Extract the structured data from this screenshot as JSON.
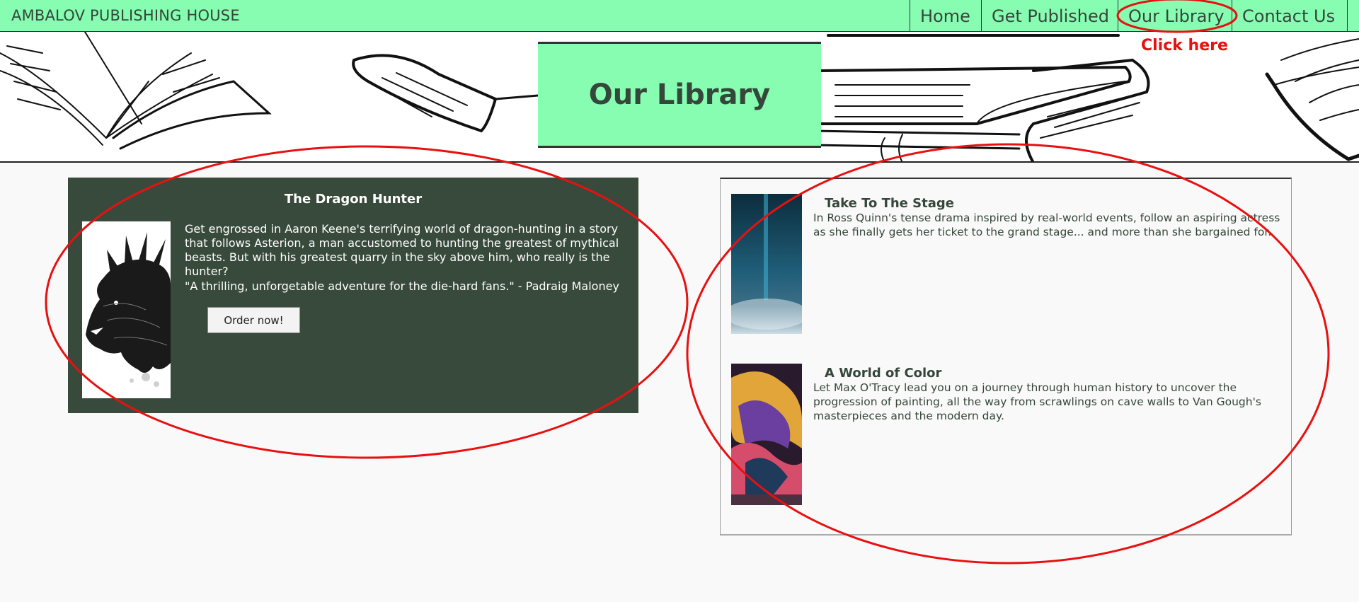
{
  "navbar": {
    "brand": "AMBALOV PUBLISHING HOUSE",
    "links": [
      {
        "label": "Home"
      },
      {
        "label": "Get Published"
      },
      {
        "label": "Our Library"
      },
      {
        "label": "Contact Us"
      }
    ],
    "bg_color": "#86fdb1"
  },
  "hero": {
    "title": "Our Library"
  },
  "featured": {
    "title": "The Dragon Hunter",
    "description": "Get engrossed in Aaron Keene's terrifying world of dragon-hunting in a story that follows Asterion, a man accustomed to hunting the greatest of mythical beasts. But with his greatest quarry in the sky above him, who really is the hunter?",
    "quote": "\"A thrilling, unforgetable adventure for the die-hard fans.\" - Padraig Maloney",
    "button_label": "Order now!",
    "bg_color": "#384a3c"
  },
  "books": [
    {
      "title": "Take To The Stage",
      "description": "In Ross Quinn's tense drama inspired by real-world events, follow an aspiring actress as she finally gets her ticket to the grand stage... and more than she bargained for."
    },
    {
      "title": "A World of Color",
      "description": "Let Max O'Tracy lead you on a journey through human history to uncover the progression of painting, all the way from scrawlings on cave walls to Van Gough's masterpieces and the modern day."
    }
  ],
  "annotation": {
    "label": "Click here",
    "color": "#e81010"
  }
}
